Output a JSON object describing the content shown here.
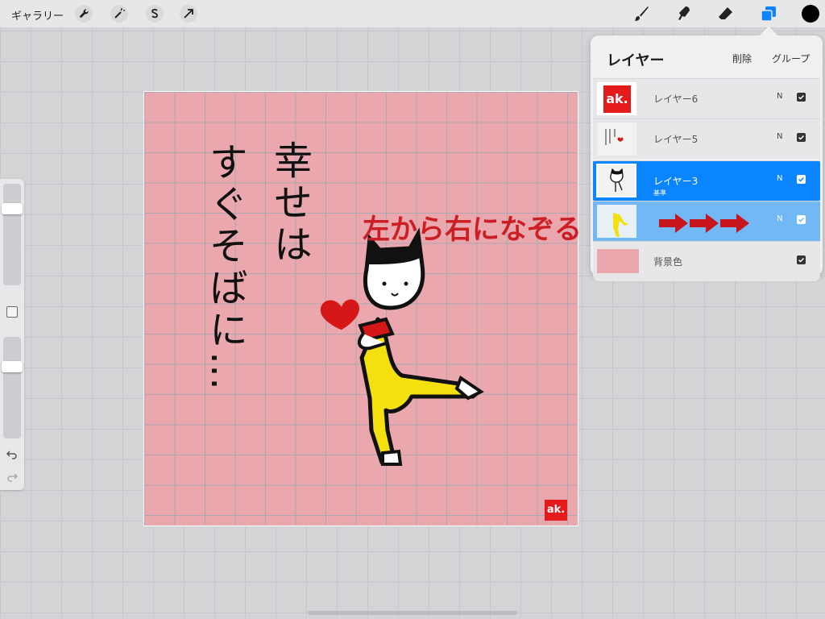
{
  "toolbar": {
    "gallery_label": "ギャラリー",
    "left_icons": [
      "wrench-icon",
      "magic-wand-icon",
      "selection-icon",
      "transform-arrow-icon"
    ],
    "right_icons": [
      "brush-icon",
      "smudge-icon",
      "eraser-icon",
      "layers-icon"
    ],
    "active_tool_color": "#0a84ff",
    "current_color": "#000000"
  },
  "sidebar": {
    "brush_size_level": 0.9,
    "opacity_level": 0.9,
    "icons": [
      "undo-icon",
      "redo-icon"
    ]
  },
  "canvas": {
    "background_color": "#eaa7ae",
    "handwritten_text": [
      "幸せは",
      "すぐそばに…"
    ],
    "instruction_text": "左から右になぞる",
    "signature": "ak."
  },
  "layers_panel": {
    "title": "レイヤー",
    "delete_label": "削除",
    "group_label": "グループ",
    "rows": [
      {
        "name": "レイヤー6",
        "blend": "N",
        "visible": true,
        "state": "normal"
      },
      {
        "name": "レイヤー5",
        "blend": "N",
        "visible": true,
        "state": "normal"
      },
      {
        "name": "レイヤー3",
        "subtitle": "基準",
        "blend": "N",
        "visible": true,
        "state": "selected"
      },
      {
        "name": "",
        "blend": "N",
        "visible": true,
        "state": "secondary"
      },
      {
        "name": "背景色",
        "blend": "",
        "visible": true,
        "state": "background"
      }
    ]
  }
}
